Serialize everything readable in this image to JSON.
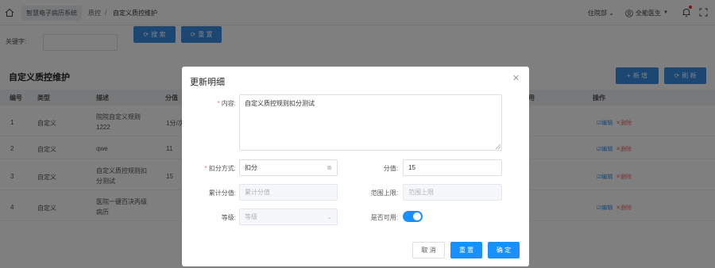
{
  "topbar": {
    "app_name": "智慧电子病历系统",
    "breadcrumb": [
      "质控",
      "自定义质控维护"
    ],
    "breadcrumb_sep": "/",
    "department": "住院部",
    "user": "全能医生"
  },
  "search": {
    "keyword_label": "关键字:",
    "keyword_value": "",
    "search_label": "搜 索",
    "reset_label": "重 置"
  },
  "panel": {
    "title": "自定义质控维护",
    "add_label": "新 增",
    "refresh_label": "刷 新"
  },
  "table": {
    "headers": [
      "编号",
      "类型",
      "描述",
      "分值",
      "用",
      "操作"
    ],
    "rows": [
      {
        "no": "1",
        "type": "自定义",
        "desc": "院院自定义规则1222",
        "score": "1分/次"
      },
      {
        "no": "2",
        "type": "自定义",
        "desc": "qwe",
        "score": "11"
      },
      {
        "no": "3",
        "type": "自定义",
        "desc": "自定义质控规则扣分测试",
        "score": "15"
      },
      {
        "no": "4",
        "type": "自定义",
        "desc": "医院一键百决丙级病历",
        "score": ""
      }
    ],
    "edit_label": "编辑",
    "delete_label": "删除"
  },
  "modal": {
    "title": "更新明细",
    "content_label": "内容:",
    "content_value": "自定义质控规则扣分测试",
    "deduct_label": "扣分方式:",
    "deduct_value": "扣分",
    "score_label": "分值:",
    "score_value": "15",
    "cumulative_label": "累计分值:",
    "cumulative_placeholder": "累计分值",
    "range_label": "范围上限:",
    "range_placeholder": "范围上限",
    "level_label": "等级:",
    "level_placeholder": "等级",
    "enabled_label": "是否可用:",
    "enabled": true,
    "cancel_label": "取 消",
    "reset_label": "重 置",
    "confirm_label": "确 定"
  },
  "colors": {
    "primary": "#1890ff",
    "danger": "#f56c6c"
  }
}
